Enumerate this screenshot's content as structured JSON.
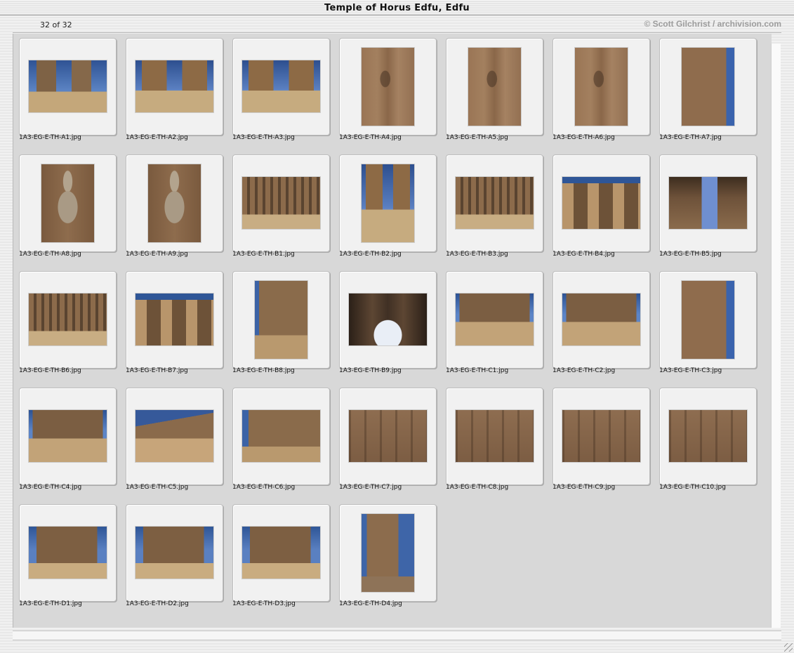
{
  "window": {
    "title": "Temple of Horus Edfu, Edfu",
    "count_label": "32 of 32",
    "credit": "© Scott Gilchrist / archivision.com"
  },
  "thumbnails": [
    {
      "filename": "1A3-EG-E-TH-A1.jpg",
      "orientation": "land",
      "photo": "ph-distant"
    },
    {
      "filename": "1A3-EG-E-TH-A2.jpg",
      "orientation": "land",
      "photo": "ph-pylon"
    },
    {
      "filename": "1A3-EG-E-TH-A3.jpg",
      "orientation": "land",
      "photo": "ph-pylon"
    },
    {
      "filename": "1A3-EG-E-TH-A4.jpg",
      "orientation": "port",
      "photo": "ph-relief-v"
    },
    {
      "filename": "1A3-EG-E-TH-A5.jpg",
      "orientation": "port",
      "photo": "ph-relief-v"
    },
    {
      "filename": "1A3-EG-E-TH-A6.jpg",
      "orientation": "port",
      "photo": "ph-relief-v"
    },
    {
      "filename": "1A3-EG-E-TH-A7.jpg",
      "orientation": "port",
      "photo": "ph-relief-sky"
    },
    {
      "filename": "1A3-EG-E-TH-A8.jpg",
      "orientation": "port",
      "photo": "ph-falcon"
    },
    {
      "filename": "1A3-EG-E-TH-A9.jpg",
      "orientation": "port",
      "photo": "ph-falcon"
    },
    {
      "filename": "1A3-EG-E-TH-B1.jpg",
      "orientation": "land",
      "photo": "ph-colonnade"
    },
    {
      "filename": "1A3-EG-E-TH-B2.jpg",
      "orientation": "port",
      "photo": "ph-pylon"
    },
    {
      "filename": "1A3-EG-E-TH-B3.jpg",
      "orientation": "land",
      "photo": "ph-colonnade"
    },
    {
      "filename": "1A3-EG-E-TH-B4.jpg",
      "orientation": "land",
      "photo": "ph-columns-close"
    },
    {
      "filename": "1A3-EG-E-TH-B5.jpg",
      "orientation": "land",
      "photo": "ph-doorway"
    },
    {
      "filename": "1A3-EG-E-TH-B6.jpg",
      "orientation": "land",
      "photo": "ph-colonnade"
    },
    {
      "filename": "1A3-EG-E-TH-B7.jpg",
      "orientation": "land",
      "photo": "ph-columns-close"
    },
    {
      "filename": "1A3-EG-E-TH-B8.jpg",
      "orientation": "port",
      "photo": "ph-wall2"
    },
    {
      "filename": "1A3-EG-E-TH-B9.jpg",
      "orientation": "land",
      "photo": "ph-hall-dark"
    },
    {
      "filename": "1A3-EG-E-TH-C1.jpg",
      "orientation": "land",
      "photo": "ph-court"
    },
    {
      "filename": "1A3-EG-E-TH-C2.jpg",
      "orientation": "land",
      "photo": "ph-court"
    },
    {
      "filename": "1A3-EG-E-TH-C3.jpg",
      "orientation": "port",
      "photo": "ph-relief-sky"
    },
    {
      "filename": "1A3-EG-E-TH-C4.jpg",
      "orientation": "land",
      "photo": "ph-court"
    },
    {
      "filename": "1A3-EG-E-TH-C5.jpg",
      "orientation": "land",
      "photo": "ph-wall"
    },
    {
      "filename": "1A3-EG-E-TH-C6.jpg",
      "orientation": "land",
      "photo": "ph-wall2"
    },
    {
      "filename": "1A3-EG-E-TH-C7.jpg",
      "orientation": "land",
      "photo": "ph-relief-h"
    },
    {
      "filename": "1A3-EG-E-TH-C8.jpg",
      "orientation": "land",
      "photo": "ph-relief-h"
    },
    {
      "filename": "1A3-EG-E-TH-C9.jpg",
      "orientation": "land",
      "photo": "ph-relief-h"
    },
    {
      "filename": "1A3-EG-E-TH-C10.jpg",
      "orientation": "land",
      "photo": "ph-relief-h"
    },
    {
      "filename": "1A3-EG-E-TH-D1.jpg",
      "orientation": "land",
      "photo": "ph-ruin"
    },
    {
      "filename": "1A3-EG-E-TH-D2.jpg",
      "orientation": "land",
      "photo": "ph-ruin"
    },
    {
      "filename": "1A3-EG-E-TH-D3.jpg",
      "orientation": "land",
      "photo": "ph-ruin"
    },
    {
      "filename": "1A3-EG-E-TH-D4.jpg",
      "orientation": "port",
      "photo": "ph-ruin-pillars"
    }
  ]
}
